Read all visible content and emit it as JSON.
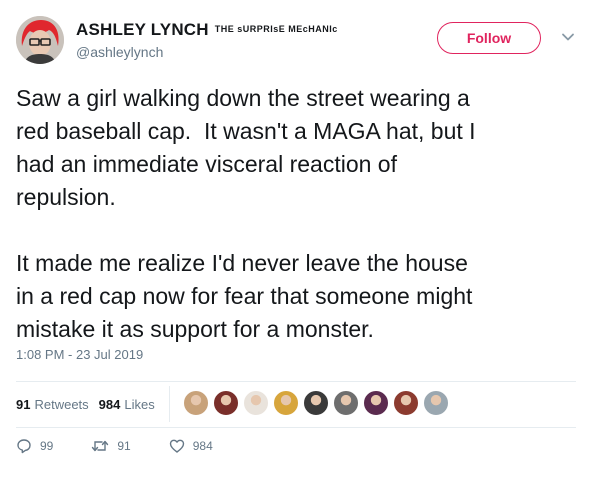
{
  "user": {
    "display_name": "ASHLEY LYNCH",
    "tagline": "THE sURPRIsE MEcHANIc",
    "handle": "@ashleylynch"
  },
  "follow_label": "Follow",
  "tweet": {
    "text": "Saw a girl walking down the street wearing a\nred baseball cap.  It wasn't a MAGA hat, but I\nhad an immediate visceral reaction of\nrepulsion.\n\nIt made me realize I'd never leave the house\nin a red cap now for fear that someone might\nmistake it as support for a monster.",
    "timestamp": "1:08 PM - 23 Jul 2019"
  },
  "stats": {
    "retweets_count": "91",
    "retweets_label": "Retweets",
    "likes_count": "984",
    "likes_label": "Likes"
  },
  "liker_avatars": [
    {
      "color": "#c8a27a"
    },
    {
      "color": "#7a2f2a"
    },
    {
      "color": "#e9e3dc"
    },
    {
      "color": "#d7a53c"
    },
    {
      "color": "#3a3a3a"
    },
    {
      "color": "#6e6e6e"
    },
    {
      "color": "#5b2b4f"
    },
    {
      "color": "#8c3b2f"
    },
    {
      "color": "#9aa7b0"
    }
  ],
  "actions": {
    "reply_count": "99",
    "retweet_count": "91",
    "like_count": "984"
  },
  "colors": {
    "accent": "#e0245e",
    "muted": "#657786",
    "avatar_hair": "#e0272e"
  }
}
